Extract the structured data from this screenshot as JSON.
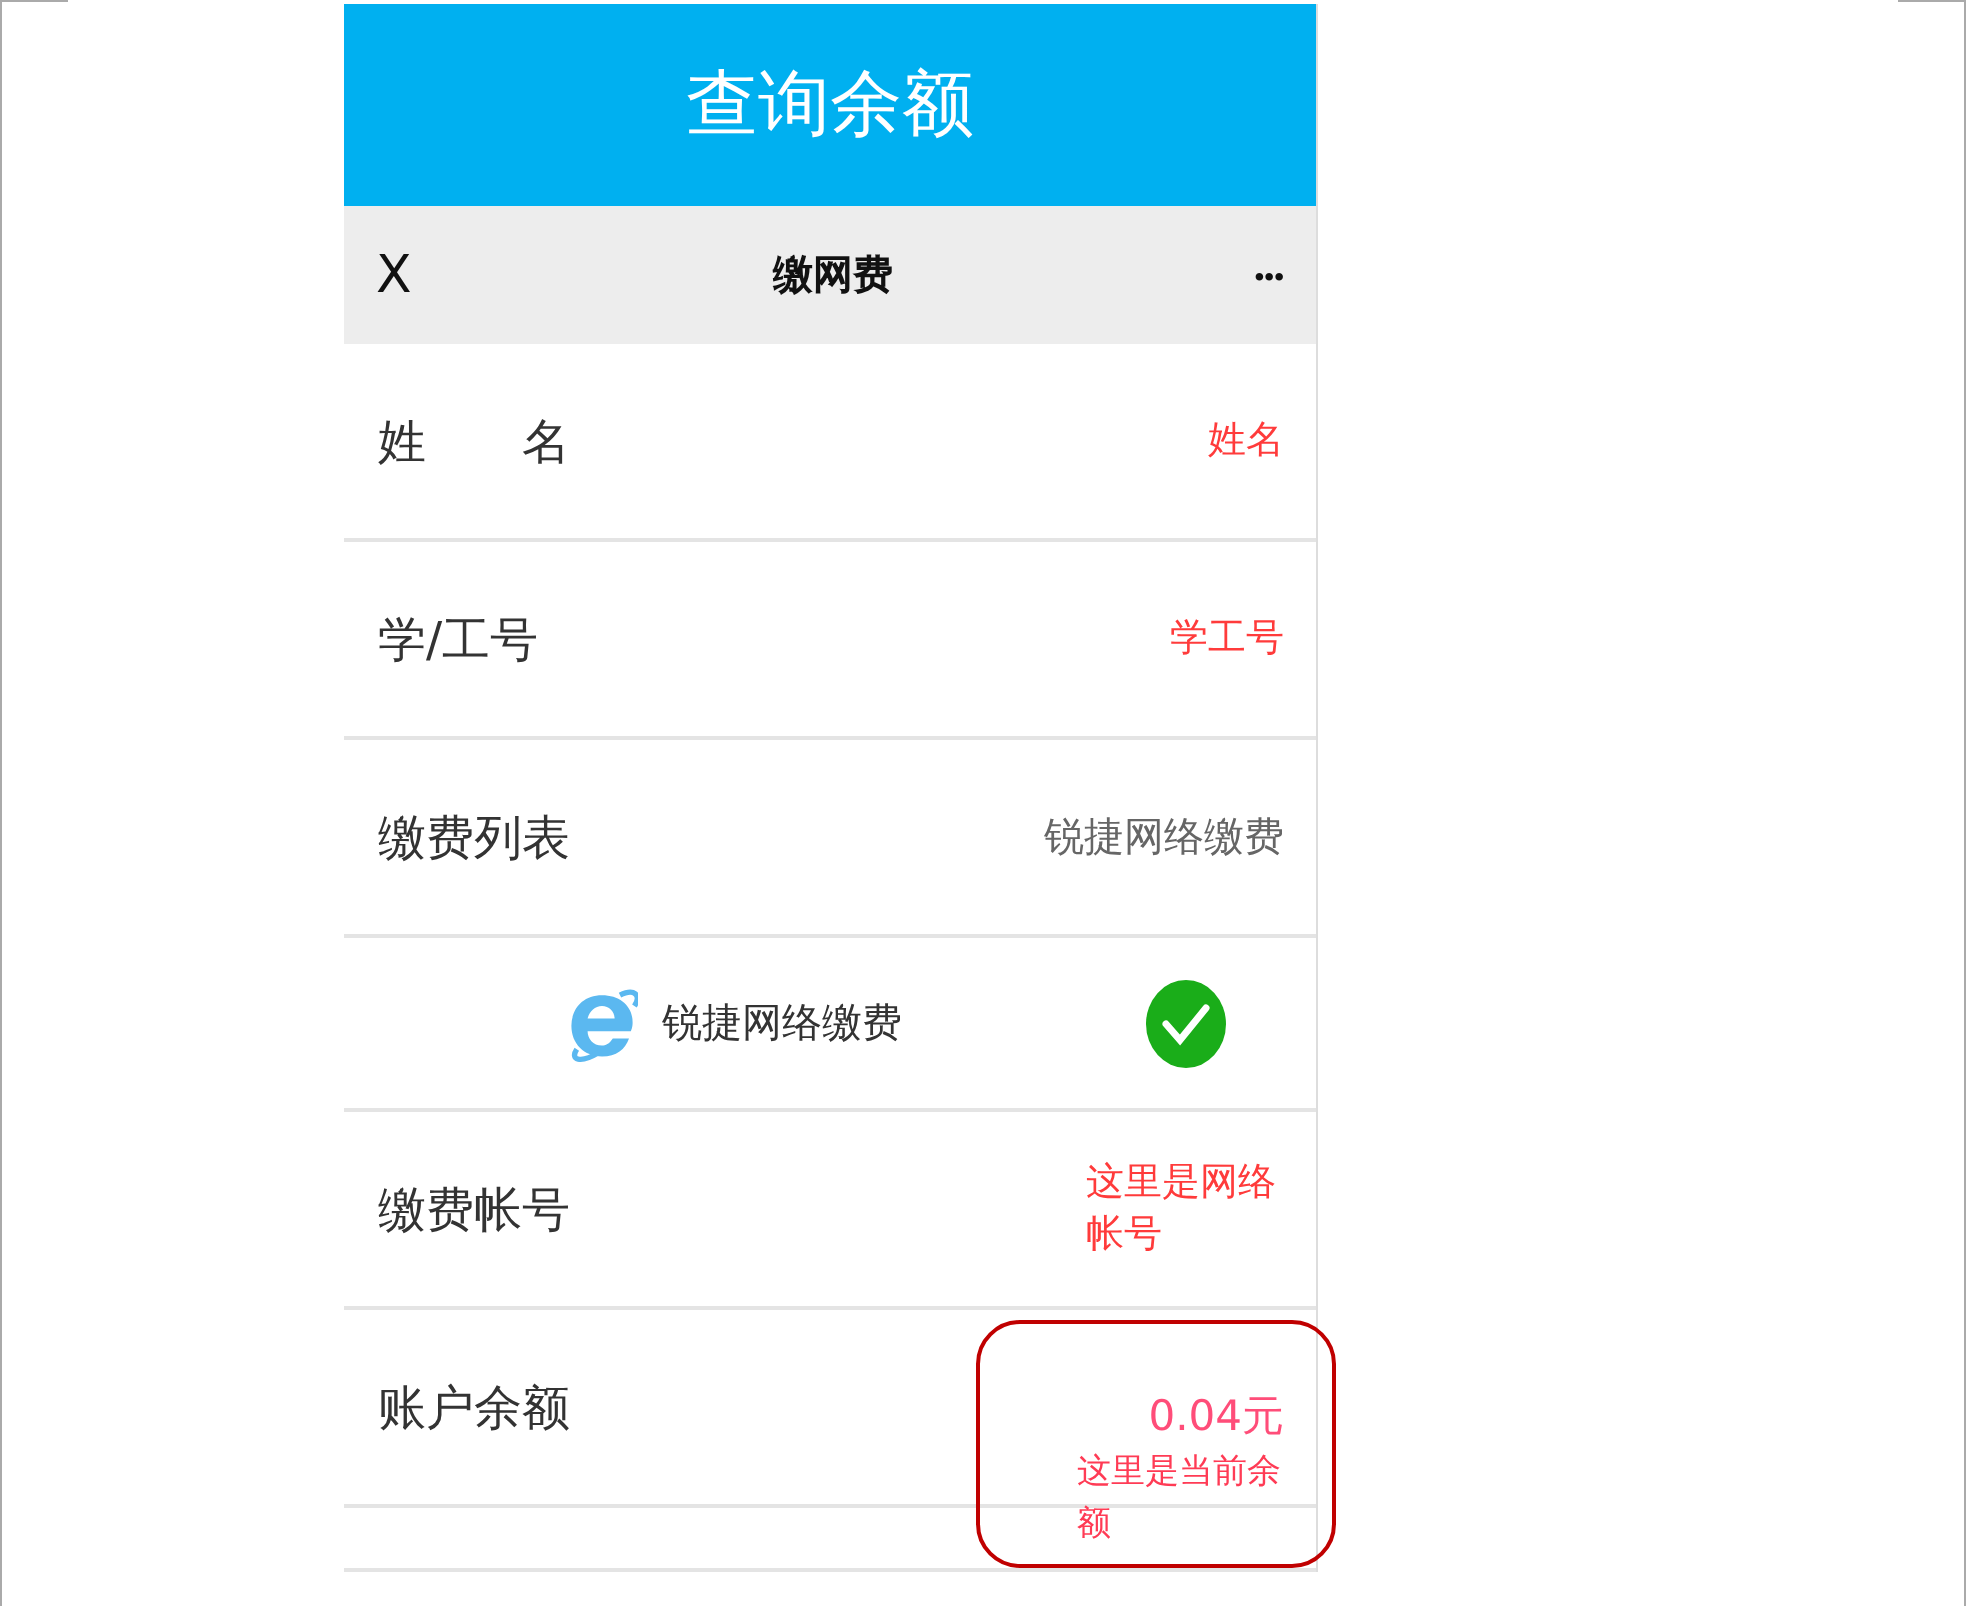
{
  "header": {
    "title": "查询余额"
  },
  "navbar": {
    "close": "X",
    "title": "缴网费",
    "more": "•••"
  },
  "rows": [
    {
      "kind": "field",
      "label": "姓　　名",
      "value": "姓名",
      "annotated": true
    },
    {
      "kind": "field",
      "label": "学/工号",
      "value": "学工号",
      "annotated": true
    },
    {
      "kind": "field",
      "label": "缴费列表",
      "value": "锐捷网络缴费",
      "annotated": false
    },
    {
      "kind": "option",
      "name": "锐捷网络缴费",
      "selected": true
    },
    {
      "kind": "field",
      "label": "缴费帐号",
      "value": "这里是网络帐号",
      "annotated": true
    },
    {
      "kind": "balance",
      "label": "账户余额",
      "value": "0.04元",
      "note": "这里是当前余额",
      "highlighted": true
    },
    {
      "kind": "empty"
    }
  ]
}
